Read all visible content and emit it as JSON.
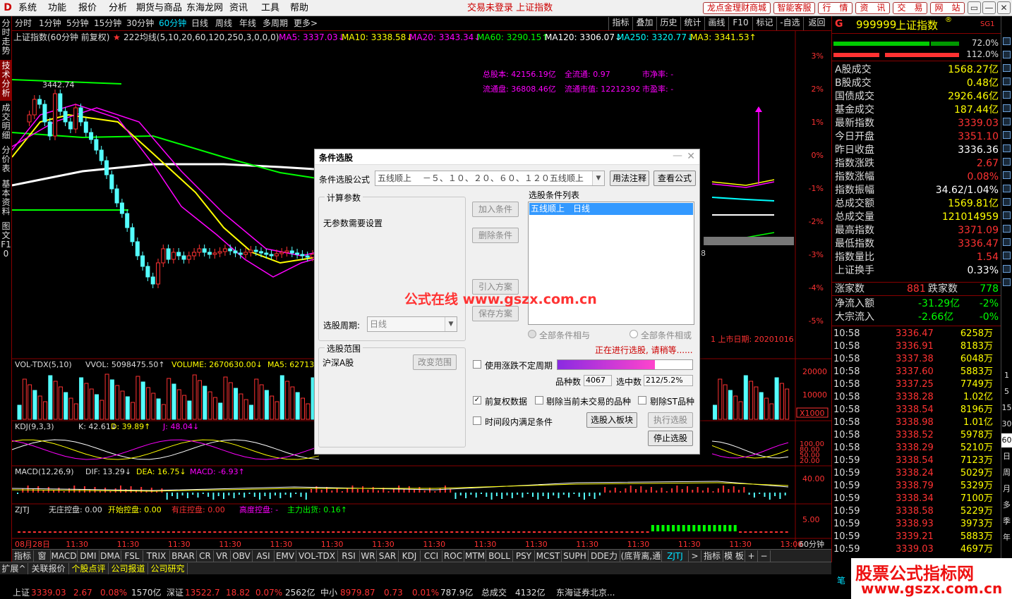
{
  "menu": {
    "logo": "D",
    "items": [
      "系统",
      "功能",
      "报价",
      "分析",
      "期货与商品",
      "东海龙网",
      "资讯",
      "工具",
      "帮助"
    ],
    "center_title": "交易未登录 上证指数",
    "buttons": [
      "龙点金理财商城",
      "智能客服",
      "行　情",
      "资　讯",
      "交　易",
      "网　站"
    ],
    "window_buttons": [
      "▭",
      "—",
      "✕"
    ]
  },
  "left_tabs": [
    "分时走势",
    "技术分析",
    "成交明细",
    "分价表",
    "基本资料",
    "图文F10"
  ],
  "periods": [
    "分时",
    "1分钟",
    "5分钟",
    "15分钟",
    "30分钟",
    "60分钟",
    "日线",
    "周线",
    "年线",
    "多周期",
    "更多>"
  ],
  "active_period": "60分钟",
  "tools": [
    "指标",
    "叠加",
    "历史",
    "统计",
    "画线",
    "F10",
    "标记",
    "-自选",
    "返回"
  ],
  "main_info": {
    "title": "上证指数(60分钟 前复权)",
    "star": "★",
    "ma_name": "222均线(5,10,20,60,120,250,3,0,0,0)",
    "ma5": "MA5: 3337.03↓",
    "ma10": "MA10: 3338.58↓",
    "ma20": "MA20: 3343.34↓",
    "ma60": "MA60: 3290.15↑",
    "ma120": "MA120: 3306.07↓",
    "ma250": "MA250: 3320.77↓",
    "ma3": "MA3: 3341.53↑"
  },
  "colors": {
    "ma5": "#ff00ff",
    "ma10": "#ffff00",
    "ma20": "#ff00ff",
    "ma60": "#00ff00",
    "ma120": "#ffffff",
    "ma250": "#00ffff",
    "ma3": "#ffff00",
    "up": "#ff3232",
    "down": "#54ffff"
  },
  "chart_annotations": {
    "high_label": "3442.74",
    "low_hint": "8",
    "fundamentals": [
      "总股本: 42156.19亿",
      "全流通: 0.97",
      "市净率: -",
      "流通盘: 36808.46亿",
      "流通市值: 12212392",
      "市盈率: -"
    ],
    "listing": "1 上市日期: 20201016"
  },
  "y_axis_pct": [
    "3%",
    "2%",
    "1%",
    "0%",
    "-1%",
    "-2%",
    "-3%",
    "-4%",
    "-5%"
  ],
  "vol_panel": {
    "name": "VOL-TDX(5,10)",
    "vvol": "VVOL: 5098475.50↑",
    "volume": "VOLUME: 2670630.00↓",
    "ma5": "MA5: 627130",
    "axis": [
      "20000",
      "10000",
      "X1000"
    ]
  },
  "kdj_panel": {
    "name": "KDJ(9,3,3)",
    "k": "K: 42.61↓",
    "d": "D: 39.89↑",
    "j": "J: 48.04↓",
    "axis": [
      "100.00",
      "80.00",
      "50.00",
      "20.00"
    ]
  },
  "macd_panel": {
    "name": "MACD(12,26,9)",
    "dif": "DIF: 13.29↓",
    "dea": "DEA: 16.75↓",
    "macd": "MACD: -6.93↑",
    "axis": [
      "40.00"
    ]
  },
  "zjtj_panel": {
    "name": "ZJTJ",
    "a": "无庄控盘: 0.00",
    "b": "开始控盘: 0.00",
    "c": "有庄控盘: 0.00",
    "d": "高度控盘: -",
    "e": "主力出货: 0.16↑",
    "axis": [
      "5.00"
    ]
  },
  "time_axis": [
    "08月28日",
    "11:30",
    "11:30",
    "11:30",
    "11:30",
    "11:30",
    "11:30",
    "11:30",
    "11:30",
    "11:30",
    "11:30",
    "11:30",
    "11:30",
    "11:30",
    "11:30",
    "13:00"
  ],
  "time_period": "60分钟",
  "bottom_tabs1": [
    "指标A",
    "窗口",
    "MACD",
    "DMI",
    "DMA",
    "FSL",
    "TRIX",
    "BRAR",
    "CR",
    "VR",
    "OBV",
    "ASI",
    "EMV",
    "VOL-TDX",
    "RSI",
    "WR",
    "SAR",
    "KDJ",
    "CCI",
    "ROC",
    "MTM",
    "BOLL",
    "PSY",
    "MCST",
    "SUPH",
    "DDE力度",
    "(底背离,通达",
    "ZJTJ",
    ">",
    "指标B",
    "模 板",
    "+",
    "−"
  ],
  "bottom_tabs2": [
    "扩展^",
    "关联报价",
    "个股点评",
    "公司报道",
    "公司研究"
  ],
  "status": {
    "sh_name": "上证",
    "sh_val": "3339.03",
    "sh_chg": "2.67",
    "sh_pct": "0.08%",
    "sh_amt": "1570亿",
    "sz_name": "深证",
    "sz_val": "13522.7",
    "sz_chg": "18.82",
    "sz_pct": "0.07%",
    "sz_amt": "2562亿",
    "zx_name": "中小",
    "zx_val": "8979.87",
    "zx_chg": "0.73",
    "zx_pct": "0.01%",
    "zx_amt": "787.9亿",
    "total": "总成交",
    "total_val": "4132亿",
    "broker": "东海证券北京...",
    "chat": "笔"
  },
  "right_panel": {
    "code": "999999",
    "name": "上证指数",
    "reg": "®",
    "badge": "SG1",
    "mark": "G",
    "bar_pct1": "72.0%",
    "bar_pct2": "112.0%",
    "rows": [
      {
        "k": "A股成交",
        "v": "1568.27亿",
        "c": "#ffff00"
      },
      {
        "k": "B股成交",
        "v": "0.48亿",
        "c": "#ffff00"
      },
      {
        "k": "国债成交",
        "v": "2926.46亿",
        "c": "#ffff00"
      },
      {
        "k": "基金成交",
        "v": "187.44亿",
        "c": "#ffff00"
      },
      {
        "k": "最新指数",
        "v": "3339.03",
        "c": "#ff3232"
      },
      {
        "k": "今日开盘",
        "v": "3351.10",
        "c": "#ff3232"
      },
      {
        "k": "昨日收盘",
        "v": "3336.36",
        "c": "#ffffff"
      },
      {
        "k": "指数涨跌",
        "v": "2.67",
        "c": "#ff3232"
      },
      {
        "k": "指数涨幅",
        "v": "0.08%",
        "c": "#ff3232"
      },
      {
        "k": "指数振幅",
        "v": "34.62/1.04%",
        "c": "#ffffff"
      },
      {
        "k": "总成交额",
        "v": "1569.81亿",
        "c": "#ffff00"
      },
      {
        "k": "总成交量",
        "v": "121014959",
        "c": "#ffff00"
      },
      {
        "k": "最高指数",
        "v": "3371.09",
        "c": "#ff3232"
      },
      {
        "k": "最低指数",
        "v": "3336.47",
        "c": "#ff3232"
      },
      {
        "k": "指数量比",
        "v": "1.54",
        "c": "#ff3232"
      },
      {
        "k": "上证换手",
        "v": "0.33%",
        "c": "#ffffff"
      }
    ],
    "updown": {
      "up_label": "涨家数",
      "up": "881",
      "down_label": "跌家数",
      "down": "778"
    },
    "flow": [
      {
        "k": "净流入额",
        "v": "-31.29亿",
        "p": "-2%"
      },
      {
        "k": "大宗流入",
        "v": "-2.66亿",
        "p": "-0%"
      }
    ],
    "ticks": [
      {
        "t": "10:58",
        "p": "3336.47",
        "v": "6258万"
      },
      {
        "t": "10:58",
        "p": "3336.91",
        "v": "8183万"
      },
      {
        "t": "10:58",
        "p": "3337.38",
        "v": "6048万"
      },
      {
        "t": "10:58",
        "p": "3337.60",
        "v": "5883万"
      },
      {
        "t": "10:58",
        "p": "3337.25",
        "v": "7749万"
      },
      {
        "t": "10:58",
        "p": "3338.28",
        "v": "1.02亿"
      },
      {
        "t": "10:58",
        "p": "3338.54",
        "v": "8196万"
      },
      {
        "t": "10:58",
        "p": "3338.98",
        "v": "1.01亿"
      },
      {
        "t": "10:58",
        "p": "3338.52",
        "v": "5978万"
      },
      {
        "t": "10:58",
        "p": "3338.29",
        "v": "5210万"
      },
      {
        "t": "10:59",
        "p": "3338.54",
        "v": "7123万"
      },
      {
        "t": "10:59",
        "p": "3338.24",
        "v": "5029万"
      },
      {
        "t": "10:59",
        "p": "3338.79",
        "v": "5329万"
      },
      {
        "t": "10:59",
        "p": "3338.34",
        "v": "7100万"
      },
      {
        "t": "10:59",
        "p": "3338.58",
        "v": "5229万"
      },
      {
        "t": "10:59",
        "p": "3338.93",
        "v": "3973万"
      },
      {
        "t": "10:59",
        "p": "3339.21",
        "v": "5883万"
      },
      {
        "t": "10:59",
        "p": "3339.03",
        "v": "4697万"
      }
    ]
  },
  "right_side_tabs": [
    "1",
    "5",
    "15",
    "30",
    "60",
    "日",
    "周",
    "月",
    "多",
    "季",
    "年"
  ],
  "dialog": {
    "title": "条件选股",
    "formula_label": "条件选股公式",
    "formula_value": "五线顺上　 －５、１０、２０、６０、１２０五线顺上",
    "usage_btn": "用法注释",
    "view_btn": "查看公式",
    "calc_group": "计算参数",
    "no_param": "无参数需要设置",
    "period_label": "选股周期:",
    "period_value": "日线",
    "add_btn": "加入条件",
    "del_btn": "删除条件",
    "import_btn": "引入方案",
    "save_btn": "保存方案",
    "list_label": "选股条件列表",
    "list_items": [
      "五线顺上　日线"
    ],
    "and_label": "全部条件相与",
    "or_label": "全部条件相或",
    "running": "正在进行选股, 请稍等......",
    "range_group": "选股范围",
    "range_value": "沪深A股",
    "change_range_btn": "改变范围",
    "use_limit": "使用涨跌不定周期",
    "count_label": "品种数",
    "count_value": "4067",
    "selected_label": "选中数",
    "selected_value": "212/5.2%",
    "progress": 0.72,
    "opt_fq": "前复权数据",
    "opt_exclude": "剔除当前未交易的品种",
    "opt_st": "剔除ST品种",
    "opt_time": "时间段内满足条件",
    "to_block_btn": "选股入板块",
    "exec_btn": "执行选股",
    "stop_btn": "停止选股"
  },
  "watermark_center": "公式在线  www.gszx.com.cn",
  "watermark_corner_top": "股票公式指标网",
  "watermark_corner_bottom": "www.gszx.com.cn"
}
